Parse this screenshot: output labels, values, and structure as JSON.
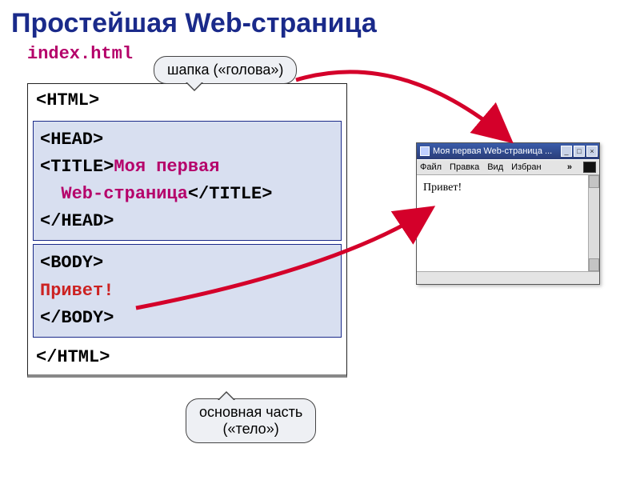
{
  "title": "Простейшая Web-страница",
  "filename": "index.html",
  "code": {
    "html_open": "<HTML>",
    "head_open": "<HEAD>",
    "title_open": "<TITLE>",
    "title_text1": "Моя первая",
    "title_text2": "Web-страница",
    "title_close": "</TITLE>",
    "head_close": "</HEAD>",
    "body_open": "<BODY>",
    "body_text": "Привет!",
    "body_close": "</BODY>",
    "html_close": "</HTML>"
  },
  "callouts": {
    "top": "шапка («голова»)",
    "bottom_line1": "основная часть",
    "bottom_line2": "(«тело»)"
  },
  "browser": {
    "title": "Моя первая Web-страница ...",
    "menu": {
      "file": "Файл",
      "edit": "Правка",
      "view": "Вид",
      "fav": "Избран",
      "chev": "»"
    },
    "content": "Привет!",
    "winbuttons": {
      "min": "_",
      "max": "□",
      "close": "×"
    }
  }
}
